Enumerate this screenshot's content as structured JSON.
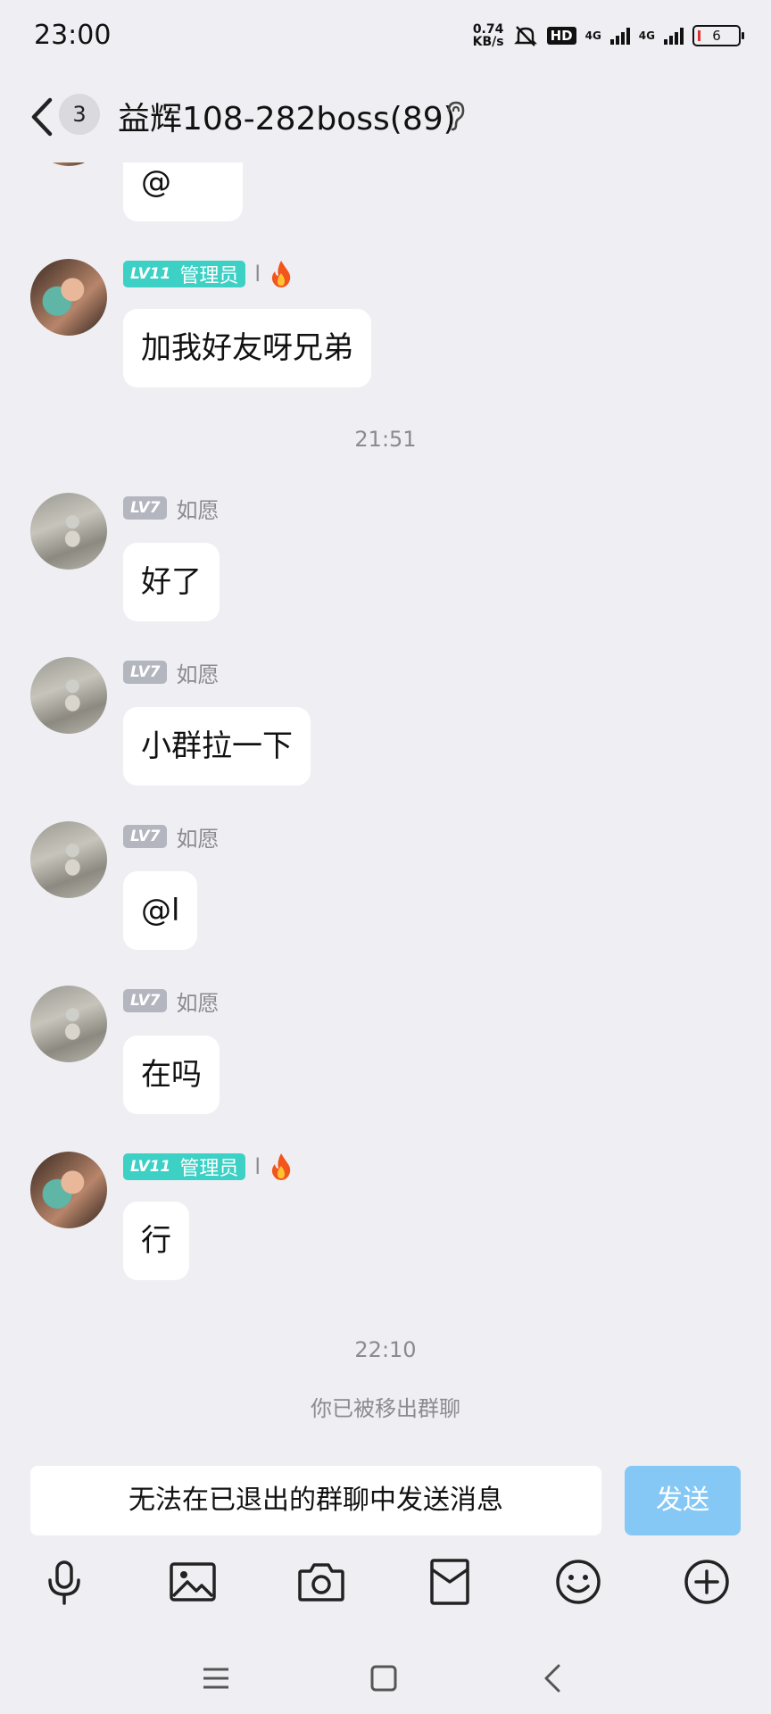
{
  "status_bar": {
    "time": "23:00",
    "net_speed_value": "0.74",
    "net_speed_unit": "KB/s",
    "hd": "HD",
    "signal_1": "4G",
    "signal_2": "4G",
    "battery": "6"
  },
  "header": {
    "unread_count": "3",
    "title": "益辉108-282boss(89)"
  },
  "messages": [
    {
      "text": "@"
    },
    {
      "badge_level": "LV11",
      "badge_role": "管理员",
      "sender": "l",
      "text": "加我好友呀兄弟"
    },
    {
      "badge_level": "LV7",
      "sender": "如愿",
      "text": "好了"
    },
    {
      "badge_level": "LV7",
      "sender": "如愿",
      "text": "小群拉一下"
    },
    {
      "badge_level": "LV7",
      "sender": "如愿",
      "text": "@l"
    },
    {
      "badge_level": "LV7",
      "sender": "如愿",
      "text": "在吗"
    },
    {
      "badge_level": "LV11",
      "badge_role": "管理员",
      "sender": "l",
      "text": "行"
    }
  ],
  "timestamps": [
    "21:51",
    "22:10"
  ],
  "system_notice": "你已被移出群聊",
  "input": {
    "disabled_text": "无法在已退出的群聊中发送消息",
    "send_label": "发送"
  },
  "toolbar_icons": [
    "microphone-icon",
    "image-icon",
    "camera-icon",
    "red-packet-icon",
    "emoji-icon",
    "plus-icon"
  ],
  "nav_icons": [
    "menu-icon",
    "home-icon",
    "back-icon"
  ],
  "colors": {
    "background": "#efeff3",
    "admin_badge": "#3dd0c4",
    "level_badge": "#b3b5bf",
    "send_button": "#85c8f5"
  }
}
